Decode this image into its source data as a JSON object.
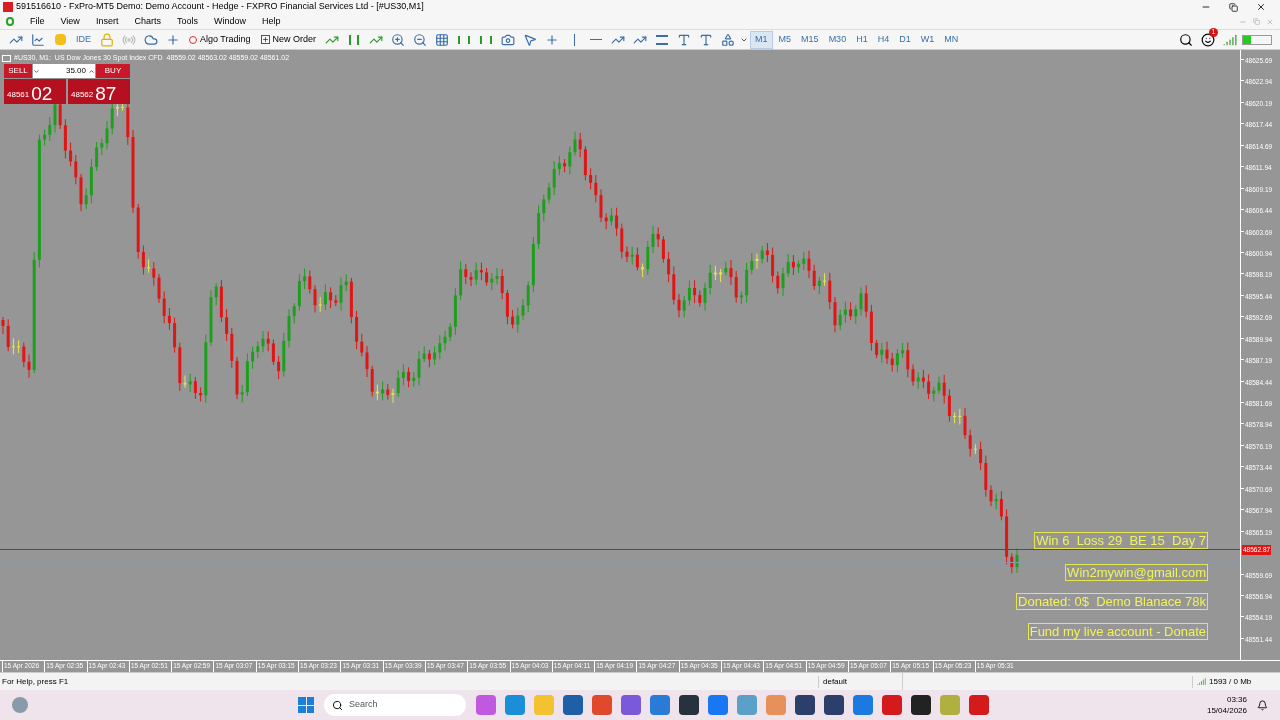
{
  "window": {
    "title": "591516610 - FxPro-MT5 Demo: Demo Account - Hedge - FXPRO Financial Services Ltd - [#US30,M1]"
  },
  "menu": [
    "File",
    "View",
    "Insert",
    "Charts",
    "Tools",
    "Window",
    "Help"
  ],
  "toolbar": {
    "ide": "IDE",
    "algo_trading": "Algo Trading",
    "new_order": "New Order",
    "notification_count": "1",
    "timeframes": [
      {
        "label": "M1",
        "selected": true
      },
      {
        "label": "M5",
        "selected": false
      },
      {
        "label": "M15",
        "selected": false
      },
      {
        "label": "M30",
        "selected": false
      },
      {
        "label": "H1",
        "selected": false
      },
      {
        "label": "H4",
        "selected": false
      },
      {
        "label": "D1",
        "selected": false
      },
      {
        "label": "W1",
        "selected": false
      },
      {
        "label": "MN",
        "selected": false
      }
    ]
  },
  "chart": {
    "header": "#US30, M1:  US Dow Jones 30 Spot Index CFD  48559.02 48563.02 48559.02 48561.02",
    "trade_panel": {
      "sell": "SELL",
      "buy": "BUY",
      "volume": "35.00",
      "bid_main": "48561",
      "bid_big": "02",
      "ask_main": "48562",
      "ask_big": "87"
    },
    "notes": [
      "Win 6  Loss 29  BE 15  Day 7",
      "Win2mywin@gmail.com",
      "Donated: 0$  Demo Blanace 78k",
      "Fund my live account - Donate"
    ],
    "price_labels": [
      "48625.69",
      "48622.94",
      "48620.19",
      "48617.44",
      "48614.69",
      "48611.94",
      "48609.19",
      "48606.44",
      "48603.69",
      "48600.94",
      "48598.19",
      "48595.44",
      "48592.69",
      "48589.94",
      "48587.19",
      "48584.44",
      "48581.69",
      "48578.94",
      "48576.19",
      "48573.44",
      "48570.69",
      "48567.94",
      "48565.19",
      "48559.69",
      "48556.94",
      "48554.19",
      "48551.44"
    ],
    "current_price": "48562.87",
    "time_labels": [
      "15 Apr 2026",
      "15 Apr 02:35",
      "15 Apr 02:43",
      "15 Apr 02:51",
      "15 Apr 02:59",
      "15 Apr 03:07",
      "15 Apr 03:15",
      "15 Apr 03:23",
      "15 Apr 03:31",
      "15 Apr 03:39",
      "15 Apr 03:47",
      "15 Apr 03:55",
      "15 Apr 04:03",
      "15 Apr 04:11",
      "15 Apr 04:19",
      "15 Apr 04:27",
      "15 Apr 04:35",
      "15 Apr 04:43",
      "15 Apr 04:51",
      "15 Apr 04:59",
      "15 Apr 05:07",
      "15 Apr 05:15",
      "15 Apr 05:23",
      "15 Apr 05:31"
    ]
  },
  "status_bar": {
    "help": "For Help, press F1",
    "profile": "default",
    "traffic": "1593 / 0 Mb"
  },
  "taskbar": {
    "search": "Search",
    "time": "03:36",
    "date": "15/04/2026"
  }
}
